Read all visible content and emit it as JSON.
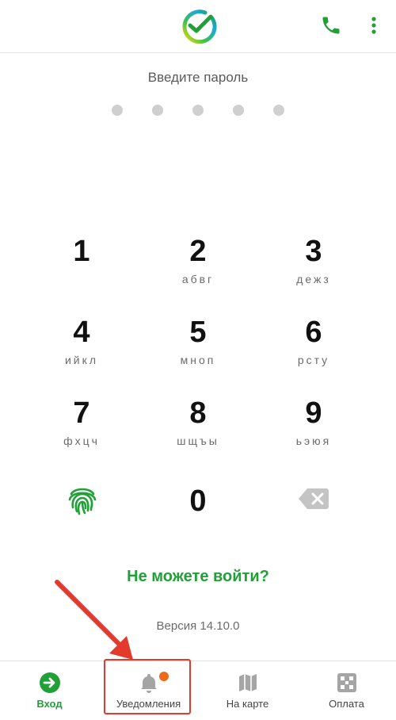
{
  "header": {
    "logo_icon": "sber-logo-icon",
    "phone_icon": "phone-icon",
    "menu_icon": "kebab-menu-icon"
  },
  "login": {
    "prompt": "Введите пароль",
    "pin_length": 5,
    "forgot_link": "Не можете войти?",
    "version": "Версия 14.10.0"
  },
  "keypad": {
    "keys": [
      {
        "num": "1",
        "letters": ""
      },
      {
        "num": "2",
        "letters": "абвг"
      },
      {
        "num": "3",
        "letters": "дежз"
      },
      {
        "num": "4",
        "letters": "ийкл"
      },
      {
        "num": "5",
        "letters": "мноп"
      },
      {
        "num": "6",
        "letters": "рсту"
      },
      {
        "num": "7",
        "letters": "фхцч"
      },
      {
        "num": "8",
        "letters": "шщъы"
      },
      {
        "num": "9",
        "letters": "ьэюя"
      },
      {
        "num": "0",
        "letters": ""
      }
    ],
    "fingerprint_icon": "fingerprint-icon",
    "backspace_icon": "backspace-icon"
  },
  "bottom_nav": {
    "items": [
      {
        "label": "Вход",
        "icon": "login-arrow-icon",
        "active": true
      },
      {
        "label": "Уведомления",
        "icon": "bell-icon",
        "active": false
      },
      {
        "label": "На карте",
        "icon": "map-icon",
        "active": false
      },
      {
        "label": "Оплата",
        "icon": "qr-code-icon",
        "active": false
      }
    ]
  },
  "colors": {
    "accent": "#21a038",
    "badge": "#ec6a1a",
    "annotation": "#e23b2e"
  }
}
